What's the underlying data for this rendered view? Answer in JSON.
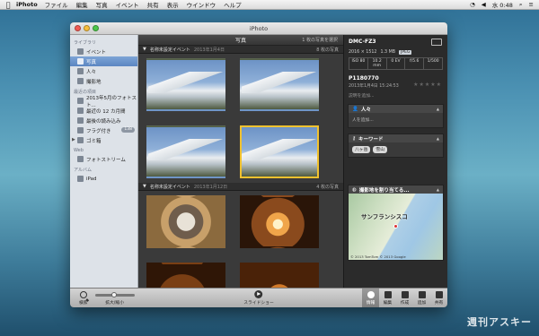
{
  "menubar": {
    "app": "iPhoto",
    "items": [
      "ファイル",
      "編集",
      "写真",
      "イベント",
      "共有",
      "表示",
      "ウインドウ",
      "ヘルプ"
    ],
    "clock": "水 0:48"
  },
  "window": {
    "title": "iPhoto"
  },
  "sidebar": {
    "sections": [
      {
        "label": "ライブラリ",
        "items": [
          {
            "label": "イベント",
            "icon": "events-icon"
          },
          {
            "label": "写真",
            "icon": "photos-icon",
            "selected": true
          },
          {
            "label": "人々",
            "icon": "people-icon"
          },
          {
            "label": "撮影地",
            "icon": "places-icon"
          }
        ]
      },
      {
        "label": "最近の項目",
        "items": [
          {
            "label": "2013年5月のフォトスト...",
            "icon": "calendar-icon"
          },
          {
            "label": "最近の 12 カ月間",
            "icon": "calendar-icon"
          },
          {
            "label": "最後の読み込み",
            "icon": "import-icon"
          },
          {
            "label": "フラグ付き",
            "icon": "flag-icon",
            "badge": "138"
          },
          {
            "label": "ゴミ箱",
            "icon": "trash-icon",
            "disclosure": true
          }
        ]
      },
      {
        "label": "Web",
        "items": [
          {
            "label": "フォトストリーム",
            "icon": "photostream-icon"
          }
        ]
      },
      {
        "label": "アルバム",
        "items": [
          {
            "label": "iPad",
            "icon": "album-icon"
          }
        ]
      }
    ]
  },
  "main": {
    "title": "写真",
    "selection": "1 枚の写真を選択",
    "events": [
      {
        "name": "名称未設定イベント",
        "date": "2013年1月4日",
        "count": "8 枚の写真",
        "photos": [
          "p-mtn",
          "p-mtn",
          "p-mtn",
          "p-mtn"
        ],
        "selected_index": 3
      },
      {
        "name": "名称未設定イベント",
        "date": "2013年1月12日",
        "count": "4 枚の写真",
        "photos": [
          "p-lamp1",
          "p-lamp2",
          "p-lamp3",
          "p-lamp4"
        ],
        "selected_index": -1
      }
    ]
  },
  "info": {
    "model": "DMC-FZ3",
    "resolution": "2016 × 1512",
    "size": "1.3 MB",
    "format": "JPEG",
    "exif": [
      "ISO 80",
      "10.2 mm",
      "0 EV",
      "f/5.6",
      "1/500"
    ],
    "filename": "P1180770",
    "datetime": "2013年1月4日 15:24:53",
    "stars": "★★★★★",
    "description_placeholder": "説明を追加...",
    "people_title": "人々",
    "people_placeholder": "人を追加...",
    "keywords_title": "キーワード",
    "keywords": [
      "八ヶ岳",
      "雪山"
    ],
    "location_title": "撮影地を割り当てる...",
    "map_label": "サンフランシスコ",
    "map_copyright": "© 2013 TomTom  © 2013 Google"
  },
  "toolbar": {
    "search": "検索",
    "zoom": "拡大/縮小",
    "slideshow": "スライドショー",
    "buttons": [
      {
        "label": "情報",
        "active": true
      },
      {
        "label": "編集",
        "active": false
      },
      {
        "label": "作成",
        "active": false
      },
      {
        "label": "追加",
        "active": false
      },
      {
        "label": "共有",
        "active": false
      }
    ]
  },
  "watermark": "週刊アスキー"
}
